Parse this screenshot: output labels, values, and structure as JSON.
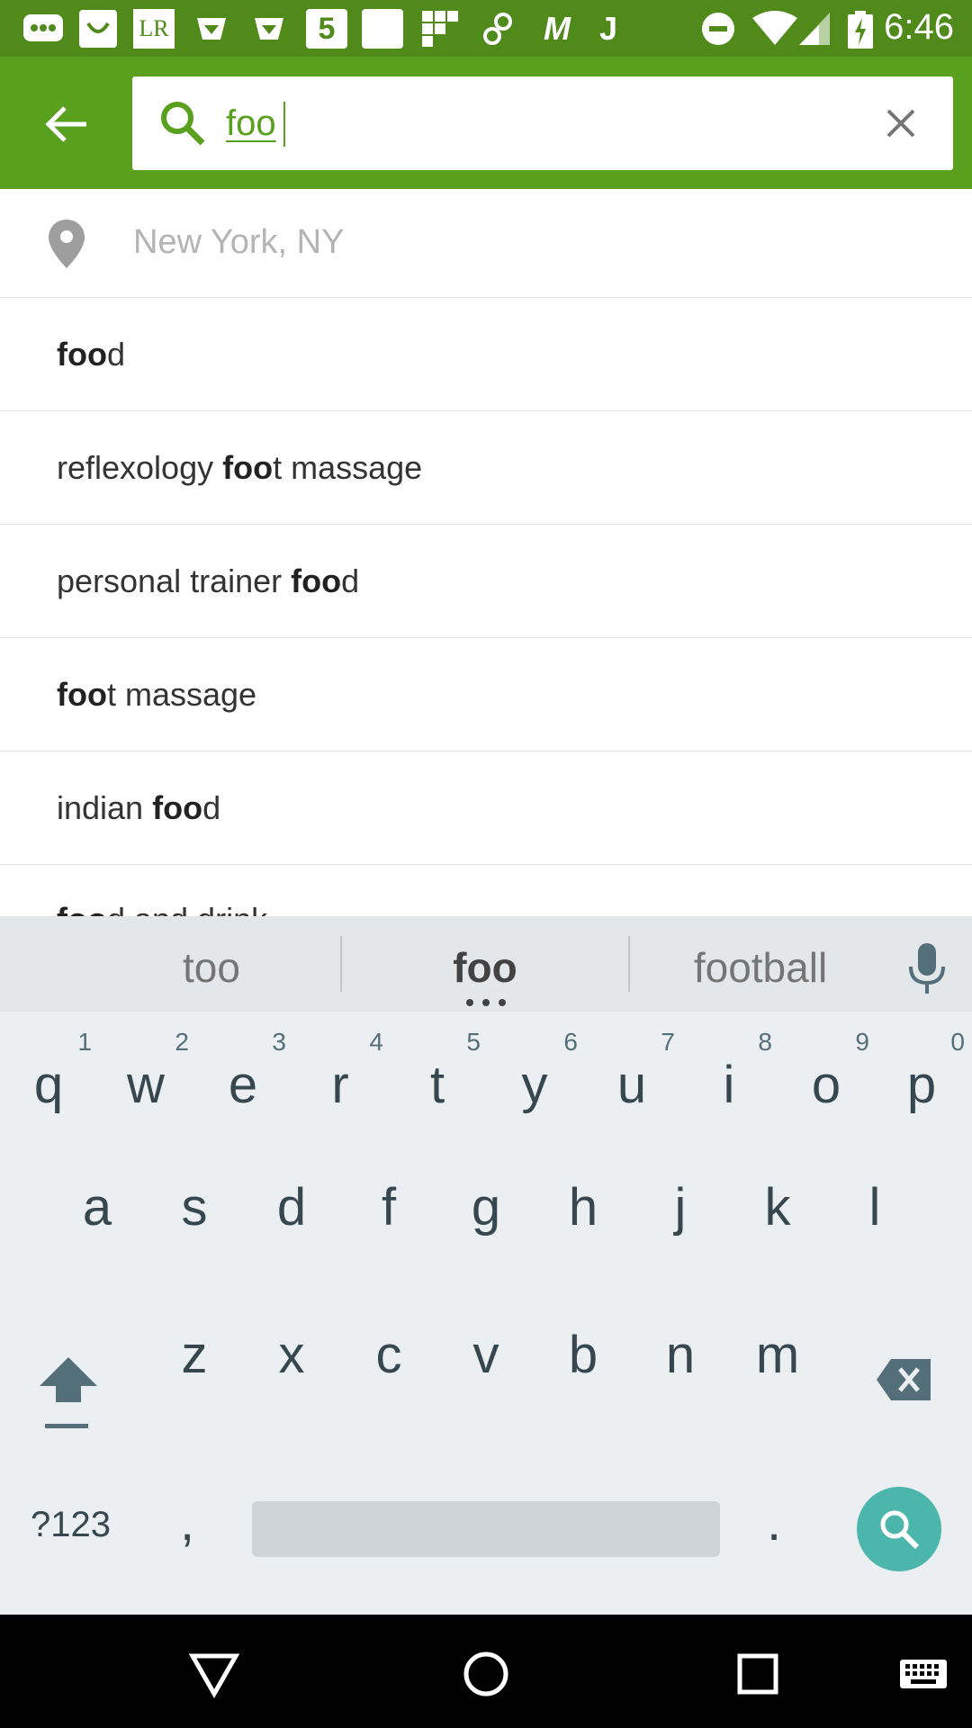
{
  "status_bar": {
    "time": "6:46",
    "notification_icons": [
      "messages-icon",
      "smile-icon",
      "lr-icon",
      "folder-icon",
      "folder-icon",
      "5-icon",
      "square-icon",
      "grid-icon",
      "link-icon",
      "m-icon",
      "j-icon"
    ],
    "notif_lr": "LR",
    "notif_5": "5",
    "notif_m": "M",
    "notif_j": "J"
  },
  "search": {
    "query": "foo",
    "accent_color": "#5aa01f"
  },
  "location": {
    "placeholder": "New York, NY"
  },
  "suggestions": [
    {
      "pre": "",
      "bold": "foo",
      "post": "d"
    },
    {
      "pre": "reflexology ",
      "bold": "foo",
      "post": "t massage"
    },
    {
      "pre": "personal trainer ",
      "bold": "foo",
      "post": "d"
    },
    {
      "pre": "",
      "bold": "foo",
      "post": "t massage"
    },
    {
      "pre": "indian ",
      "bold": "foo",
      "post": "d"
    },
    {
      "pre": "",
      "bold": "foo",
      "post": "d and drink"
    }
  ],
  "keyboard": {
    "suggestions": [
      "too",
      "foo",
      "football"
    ],
    "row1": [
      {
        "ch": "q",
        "num": "1"
      },
      {
        "ch": "w",
        "num": "2"
      },
      {
        "ch": "e",
        "num": "3"
      },
      {
        "ch": "r",
        "num": "4"
      },
      {
        "ch": "t",
        "num": "5"
      },
      {
        "ch": "y",
        "num": "6"
      },
      {
        "ch": "u",
        "num": "7"
      },
      {
        "ch": "i",
        "num": "8"
      },
      {
        "ch": "o",
        "num": "9"
      },
      {
        "ch": "p",
        "num": "0"
      }
    ],
    "row2": [
      "a",
      "s",
      "d",
      "f",
      "g",
      "h",
      "j",
      "k",
      "l"
    ],
    "row3": [
      "z",
      "x",
      "c",
      "v",
      "b",
      "n",
      "m"
    ],
    "symbols_label": "?123",
    "comma_label": ",",
    "period_label": ".",
    "search_key_color": "#4db6ac"
  }
}
